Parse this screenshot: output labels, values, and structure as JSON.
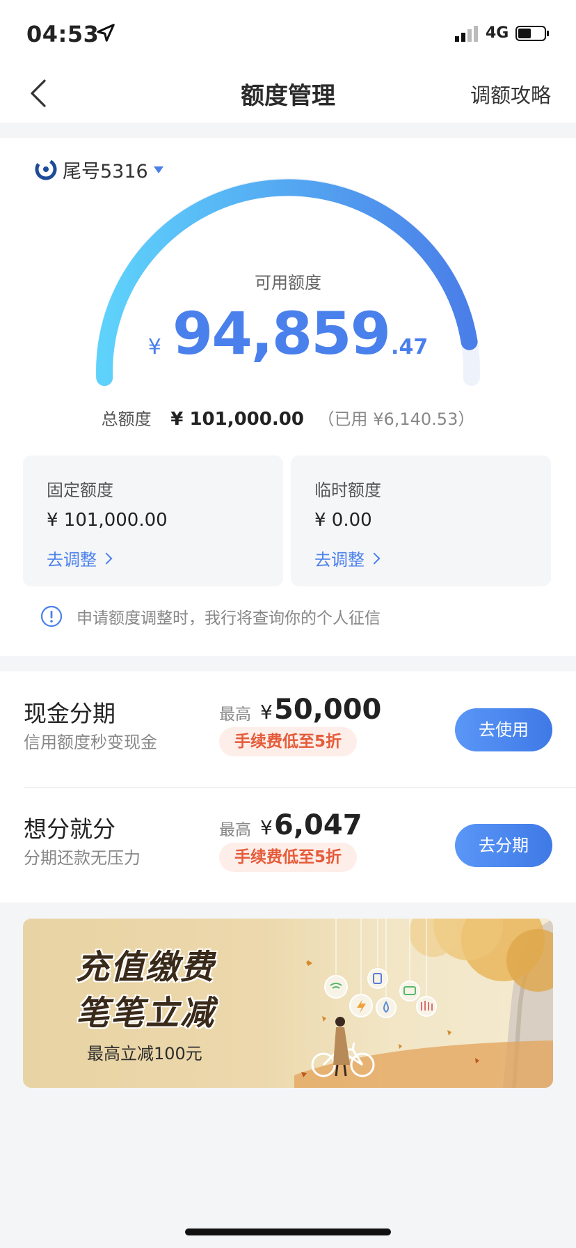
{
  "status_bar": {
    "time": "04:53",
    "network": "4G"
  },
  "nav": {
    "title": "额度管理",
    "right_action": "调额攻略"
  },
  "account": {
    "label": "尾号5316"
  },
  "credit": {
    "available_label": "可用额度",
    "currency": "¥",
    "available_int": "94,859",
    "available_dec": ".47",
    "used_fraction": 0.0608,
    "total_label": "总额度",
    "total_value": "¥ 101,000.00",
    "used_text": "（已用 ¥6,140.53）"
  },
  "quotas": [
    {
      "label": "固定额度",
      "value": "¥ 101,000.00",
      "action": "去调整"
    },
    {
      "label": "临时额度",
      "value": "¥ 0.00",
      "action": "去调整"
    }
  ],
  "notice": "申请额度调整时，我行将查询你的个人征信",
  "installments": [
    {
      "title": "现金分期",
      "subtitle": "信用额度秒变现金",
      "max_label": "最高",
      "currency": "¥",
      "max_value": "50,000",
      "fee": "手续费低至5折",
      "cta": "去使用"
    },
    {
      "title": "想分就分",
      "subtitle": "分期还款无压力",
      "max_label": "最高",
      "currency": "¥",
      "max_value": "6,047",
      "fee": "手续费低至5折",
      "cta": "去分期"
    }
  ],
  "banner": {
    "line1": "充值缴费",
    "line2": "笔笔立减",
    "sub": "最高立减100元"
  },
  "colors": {
    "accent": "#4a80ec",
    "fee_red": "#e55b3a",
    "gauge_start": "#5ed2fb",
    "gauge_end": "#4a7ee8"
  }
}
